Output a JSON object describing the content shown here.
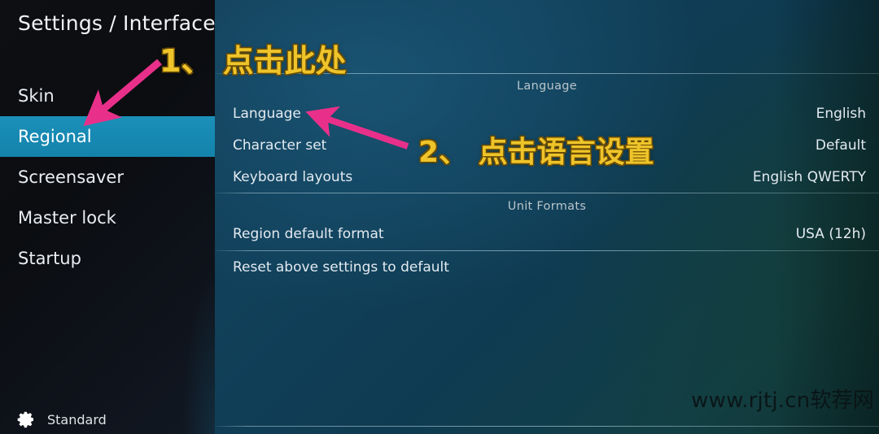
{
  "window": {
    "title": "Settings / Interface"
  },
  "sidebar": {
    "items": [
      {
        "label": "Skin",
        "selected": false
      },
      {
        "label": "Regional",
        "selected": true
      },
      {
        "label": "Screensaver",
        "selected": false
      },
      {
        "label": "Master lock",
        "selected": false
      },
      {
        "label": "Startup",
        "selected": false
      }
    ],
    "profile": {
      "icon": "gear-icon",
      "label": "Standard"
    }
  },
  "main": {
    "groups": [
      {
        "header": "Language",
        "rows": [
          {
            "label": "Language",
            "value": "English"
          },
          {
            "label": "Character set",
            "value": "Default"
          },
          {
            "label": "Keyboard layouts",
            "value": "English QWERTY"
          }
        ]
      },
      {
        "header": "Unit Formats",
        "rows": [
          {
            "label": "Region default format",
            "value": "USA (12h)"
          }
        ]
      },
      {
        "header": "",
        "rows": [
          {
            "label": "Reset above settings to default",
            "value": ""
          }
        ]
      }
    ]
  },
  "annotations": [
    {
      "id": "annot-1",
      "text": "1、 点击此处"
    },
    {
      "id": "annot-2",
      "text": "2、 点击语言设置"
    }
  ],
  "watermark": {
    "text": "www.rjtj.cn软荐网"
  },
  "colors": {
    "selection": "#1689b2",
    "annotation": "#eec42a",
    "arrow": "#e8308a",
    "panel_bg": "#11405a",
    "sidebar_bg": "#0c0f13"
  }
}
